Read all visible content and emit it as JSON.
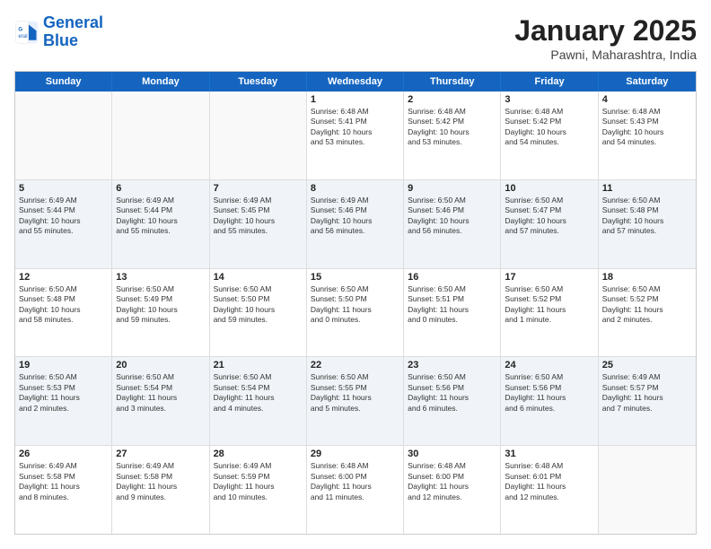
{
  "header": {
    "logo_general": "General",
    "logo_blue": "Blue",
    "month_title": "January 2025",
    "subtitle": "Pawni, Maharashtra, India"
  },
  "days_of_week": [
    "Sunday",
    "Monday",
    "Tuesday",
    "Wednesday",
    "Thursday",
    "Friday",
    "Saturday"
  ],
  "rows": [
    {
      "alt": false,
      "cells": [
        {
          "day": "",
          "text": ""
        },
        {
          "day": "",
          "text": ""
        },
        {
          "day": "",
          "text": ""
        },
        {
          "day": "1",
          "text": "Sunrise: 6:48 AM\nSunset: 5:41 PM\nDaylight: 10 hours\nand 53 minutes."
        },
        {
          "day": "2",
          "text": "Sunrise: 6:48 AM\nSunset: 5:42 PM\nDaylight: 10 hours\nand 53 minutes."
        },
        {
          "day": "3",
          "text": "Sunrise: 6:48 AM\nSunset: 5:42 PM\nDaylight: 10 hours\nand 54 minutes."
        },
        {
          "day": "4",
          "text": "Sunrise: 6:48 AM\nSunset: 5:43 PM\nDaylight: 10 hours\nand 54 minutes."
        }
      ]
    },
    {
      "alt": true,
      "cells": [
        {
          "day": "5",
          "text": "Sunrise: 6:49 AM\nSunset: 5:44 PM\nDaylight: 10 hours\nand 55 minutes."
        },
        {
          "day": "6",
          "text": "Sunrise: 6:49 AM\nSunset: 5:44 PM\nDaylight: 10 hours\nand 55 minutes."
        },
        {
          "day": "7",
          "text": "Sunrise: 6:49 AM\nSunset: 5:45 PM\nDaylight: 10 hours\nand 55 minutes."
        },
        {
          "day": "8",
          "text": "Sunrise: 6:49 AM\nSunset: 5:46 PM\nDaylight: 10 hours\nand 56 minutes."
        },
        {
          "day": "9",
          "text": "Sunrise: 6:50 AM\nSunset: 5:46 PM\nDaylight: 10 hours\nand 56 minutes."
        },
        {
          "day": "10",
          "text": "Sunrise: 6:50 AM\nSunset: 5:47 PM\nDaylight: 10 hours\nand 57 minutes."
        },
        {
          "day": "11",
          "text": "Sunrise: 6:50 AM\nSunset: 5:48 PM\nDaylight: 10 hours\nand 57 minutes."
        }
      ]
    },
    {
      "alt": false,
      "cells": [
        {
          "day": "12",
          "text": "Sunrise: 6:50 AM\nSunset: 5:48 PM\nDaylight: 10 hours\nand 58 minutes."
        },
        {
          "day": "13",
          "text": "Sunrise: 6:50 AM\nSunset: 5:49 PM\nDaylight: 10 hours\nand 59 minutes."
        },
        {
          "day": "14",
          "text": "Sunrise: 6:50 AM\nSunset: 5:50 PM\nDaylight: 10 hours\nand 59 minutes."
        },
        {
          "day": "15",
          "text": "Sunrise: 6:50 AM\nSunset: 5:50 PM\nDaylight: 11 hours\nand 0 minutes."
        },
        {
          "day": "16",
          "text": "Sunrise: 6:50 AM\nSunset: 5:51 PM\nDaylight: 11 hours\nand 0 minutes."
        },
        {
          "day": "17",
          "text": "Sunrise: 6:50 AM\nSunset: 5:52 PM\nDaylight: 11 hours\nand 1 minute."
        },
        {
          "day": "18",
          "text": "Sunrise: 6:50 AM\nSunset: 5:52 PM\nDaylight: 11 hours\nand 2 minutes."
        }
      ]
    },
    {
      "alt": true,
      "cells": [
        {
          "day": "19",
          "text": "Sunrise: 6:50 AM\nSunset: 5:53 PM\nDaylight: 11 hours\nand 2 minutes."
        },
        {
          "day": "20",
          "text": "Sunrise: 6:50 AM\nSunset: 5:54 PM\nDaylight: 11 hours\nand 3 minutes."
        },
        {
          "day": "21",
          "text": "Sunrise: 6:50 AM\nSunset: 5:54 PM\nDaylight: 11 hours\nand 4 minutes."
        },
        {
          "day": "22",
          "text": "Sunrise: 6:50 AM\nSunset: 5:55 PM\nDaylight: 11 hours\nand 5 minutes."
        },
        {
          "day": "23",
          "text": "Sunrise: 6:50 AM\nSunset: 5:56 PM\nDaylight: 11 hours\nand 6 minutes."
        },
        {
          "day": "24",
          "text": "Sunrise: 6:50 AM\nSunset: 5:56 PM\nDaylight: 11 hours\nand 6 minutes."
        },
        {
          "day": "25",
          "text": "Sunrise: 6:49 AM\nSunset: 5:57 PM\nDaylight: 11 hours\nand 7 minutes."
        }
      ]
    },
    {
      "alt": false,
      "cells": [
        {
          "day": "26",
          "text": "Sunrise: 6:49 AM\nSunset: 5:58 PM\nDaylight: 11 hours\nand 8 minutes."
        },
        {
          "day": "27",
          "text": "Sunrise: 6:49 AM\nSunset: 5:58 PM\nDaylight: 11 hours\nand 9 minutes."
        },
        {
          "day": "28",
          "text": "Sunrise: 6:49 AM\nSunset: 5:59 PM\nDaylight: 11 hours\nand 10 minutes."
        },
        {
          "day": "29",
          "text": "Sunrise: 6:48 AM\nSunset: 6:00 PM\nDaylight: 11 hours\nand 11 minutes."
        },
        {
          "day": "30",
          "text": "Sunrise: 6:48 AM\nSunset: 6:00 PM\nDaylight: 11 hours\nand 12 minutes."
        },
        {
          "day": "31",
          "text": "Sunrise: 6:48 AM\nSunset: 6:01 PM\nDaylight: 11 hours\nand 12 minutes."
        },
        {
          "day": "",
          "text": ""
        }
      ]
    }
  ]
}
